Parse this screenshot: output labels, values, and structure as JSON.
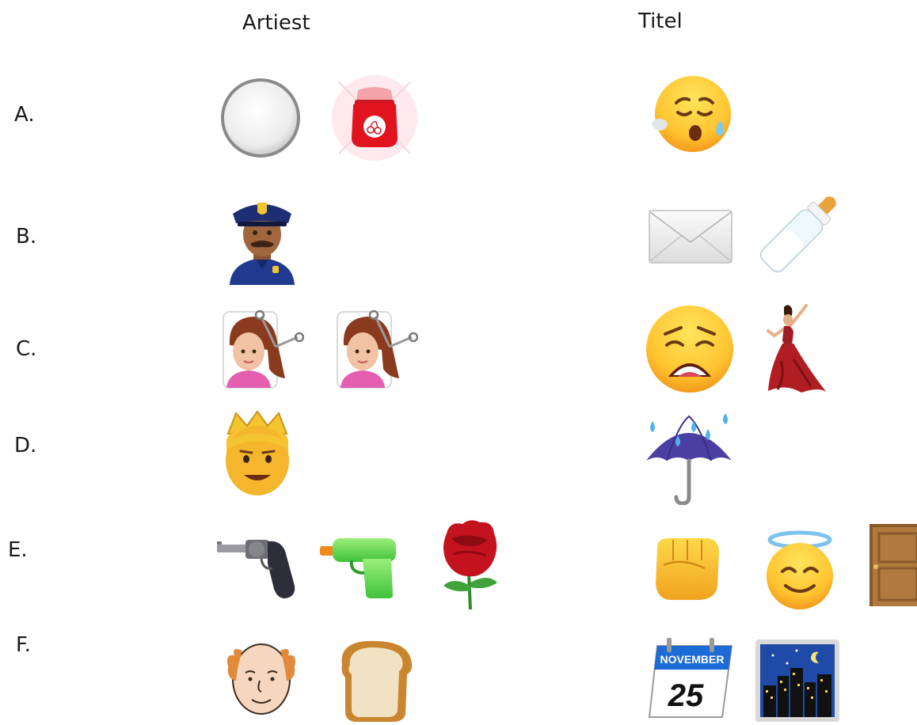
{
  "headers": {
    "artist": "Artiest",
    "title": "Titel"
  },
  "rows": [
    {
      "label": "A.",
      "artist_icons": [
        "white-circle-icon",
        "jam-jar-icon"
      ],
      "title_icons": [
        "sleepy-face-icon"
      ]
    },
    {
      "label": "B.",
      "artist_icons": [
        "police-officer-icon"
      ],
      "title_icons": [
        "envelope-icon",
        "baby-bottle-icon"
      ]
    },
    {
      "label": "C.",
      "artist_icons": [
        "haircut-icon",
        "haircut-icon"
      ],
      "title_icons": [
        "weary-face-icon",
        "dancer-icon"
      ]
    },
    {
      "label": "D.",
      "artist_icons": [
        "prince-icon"
      ],
      "title_icons": [
        "umbrella-rain-icon"
      ]
    },
    {
      "label": "E.",
      "artist_icons": [
        "revolver-icon",
        "water-pistol-icon",
        "rose-icon"
      ],
      "title_icons": [
        "fist-icon",
        "halo-face-icon",
        "door-icon"
      ]
    },
    {
      "label": "F.",
      "artist_icons": [
        "bald-man-icon",
        "bread-icon"
      ],
      "title_icons": [
        "calendar-icon",
        "night-city-icon"
      ]
    }
  ],
  "calendar": {
    "month": "NOVEMBER",
    "day": "25"
  }
}
